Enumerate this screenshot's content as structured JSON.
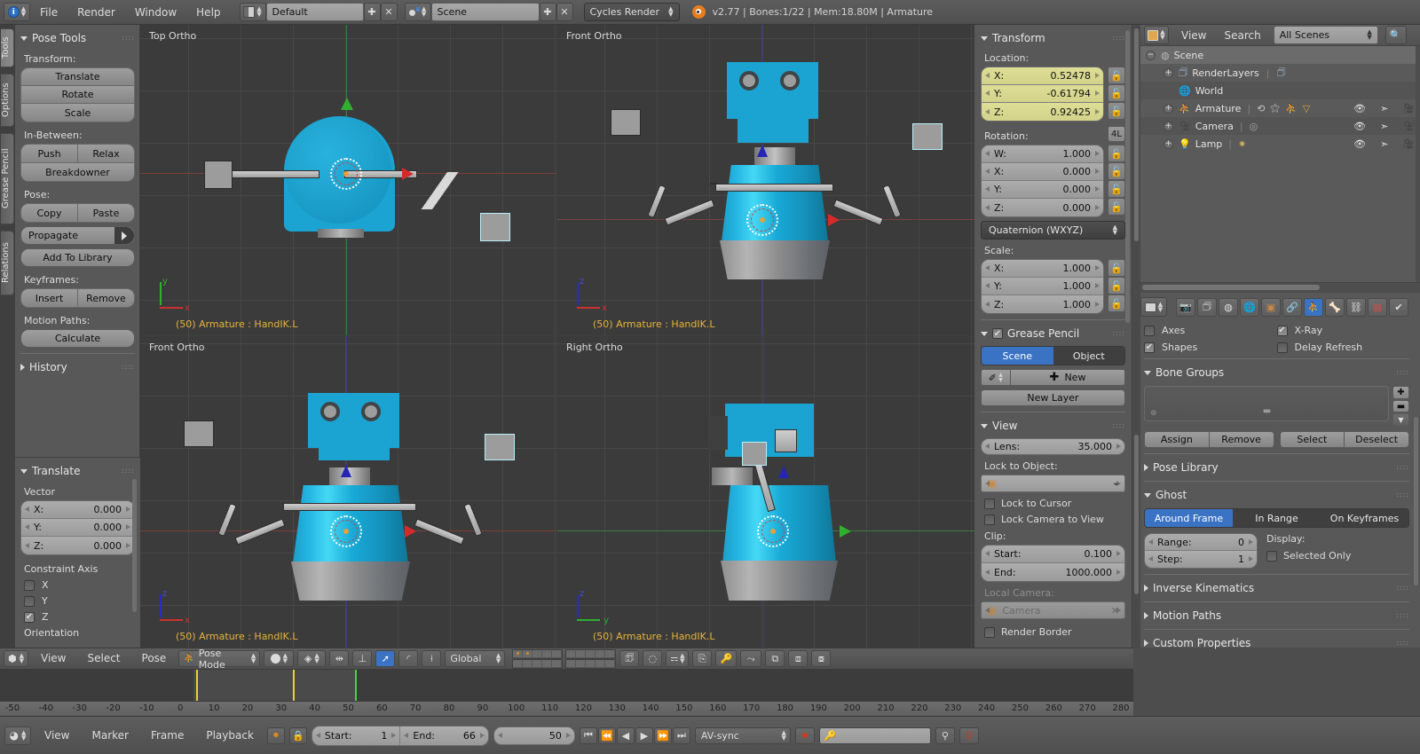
{
  "app": {
    "version_info": "v2.77 | Bones:1/22 | Mem:18.80M | Armature",
    "menus": [
      "File",
      "Render",
      "Window",
      "Help"
    ],
    "screen_layout": "Default",
    "scene_name": "Scene",
    "render_engine": "Cycles Render"
  },
  "toolshelf": {
    "tabs": [
      "Tools",
      "Options",
      "Grease Pencil",
      "Relations"
    ],
    "active_tab": "Tools",
    "panel_title": "Pose Tools",
    "groups": [
      {
        "label": "Transform:",
        "buttons": [
          "Translate",
          "Rotate",
          "Scale"
        ]
      },
      {
        "label": "In-Between:",
        "buttons": [
          "Push",
          "Relax",
          "Breakdowner"
        ]
      },
      {
        "label": "Pose:",
        "buttons": [
          "Copy",
          "Paste",
          "Propagate",
          "Add To Library"
        ]
      },
      {
        "label": "Keyframes:",
        "buttons": [
          "Insert",
          "Remove"
        ]
      },
      {
        "label": "Motion Paths:",
        "buttons": [
          "Calculate"
        ]
      }
    ],
    "history_title": "History"
  },
  "operator_panel": {
    "title": "Translate",
    "vector_label": "Vector",
    "vector": [
      {
        "label": "X:",
        "value": "0.000"
      },
      {
        "label": "Y:",
        "value": "0.000"
      },
      {
        "label": "Z:",
        "value": "0.000"
      }
    ],
    "constraint_label": "Constraint Axis",
    "axes": [
      {
        "label": "X",
        "checked": false
      },
      {
        "label": "Y",
        "checked": false
      },
      {
        "label": "Z",
        "checked": true
      }
    ],
    "orientation_label": "Orientation"
  },
  "viewports": [
    {
      "name": "Top Ortho",
      "info": "(50) Armature : HandIK.L",
      "gizmo": [
        "y",
        "x"
      ]
    },
    {
      "name": "Front Ortho",
      "info": "(50) Armature : HandIK.L",
      "gizmo": [
        "z",
        "x"
      ]
    },
    {
      "name": "Front Ortho",
      "info": "(50) Armature : HandIK.L",
      "gizmo": [
        "z",
        "x"
      ]
    },
    {
      "name": "Right Ortho",
      "info": "(50) Armature : HandIK.L",
      "gizmo": [
        "z",
        "y"
      ]
    }
  ],
  "properties": {
    "transform": {
      "title": "Transform",
      "location_label": "Location:",
      "location": [
        {
          "label": "X:",
          "value": "0.52478"
        },
        {
          "label": "Y:",
          "value": "-0.61794"
        },
        {
          "label": "Z:",
          "value": "0.92425"
        }
      ],
      "rotation_label": "Rotation:",
      "rotation_mode_badge": "4L",
      "rotation": [
        {
          "label": "W:",
          "value": "1.000"
        },
        {
          "label": "X:",
          "value": "0.000"
        },
        {
          "label": "Y:",
          "value": "0.000"
        },
        {
          "label": "Z:",
          "value": "0.000"
        }
      ],
      "rotation_mode": "Quaternion (WXYZ)",
      "scale_label": "Scale:",
      "scale": [
        {
          "label": "X:",
          "value": "1.000"
        },
        {
          "label": "Y:",
          "value": "1.000"
        },
        {
          "label": "Z:",
          "value": "1.000"
        }
      ]
    },
    "grease_pencil": {
      "title": "Grease Pencil",
      "enabled": true,
      "toggle": [
        "Scene",
        "Object"
      ],
      "active_toggle": "Scene",
      "new_button": "New",
      "new_layer_button": "New Layer"
    },
    "view": {
      "title": "View",
      "lens": {
        "label": "Lens:",
        "value": "35.000"
      },
      "lock_to_object_label": "Lock to Object:",
      "lock_to_object_value": "",
      "lock_to_cursor": "Lock to Cursor",
      "lock_camera_to_view": "Lock Camera to View",
      "clip_label": "Clip:",
      "clip_start": {
        "label": "Start:",
        "value": "0.100"
      },
      "clip_end": {
        "label": "End:",
        "value": "1000.000"
      },
      "local_camera_label": "Local Camera:",
      "local_camera_value": "Camera",
      "render_border": "Render Border"
    }
  },
  "outliner": {
    "menus": [
      "View",
      "Search"
    ],
    "scope": "All Scenes",
    "rows": [
      {
        "name": "Scene",
        "icon": "scene-icon",
        "depth": 0,
        "expander": "minus",
        "highlight": true,
        "extra": []
      },
      {
        "name": "RenderLayers",
        "icon": "renderlayers-icon",
        "depth": 1,
        "expander": "plus",
        "highlight": false,
        "extra": [
          "renderlayer"
        ]
      },
      {
        "name": "World",
        "icon": "world-icon",
        "depth": 1,
        "expander": "none",
        "highlight": false,
        "extra": []
      },
      {
        "name": "Armature",
        "icon": "armature-icon",
        "depth": 1,
        "expander": "plus",
        "highlight": false,
        "extra": [
          "modifier",
          "pose",
          "armature-data",
          "cone"
        ],
        "visibility": true
      },
      {
        "name": "Camera",
        "icon": "camera-icon",
        "depth": 1,
        "expander": "plus",
        "highlight": false,
        "extra": [
          "camera-data"
        ],
        "visibility": true
      },
      {
        "name": "Lamp",
        "icon": "lamp-icon",
        "depth": 1,
        "expander": "plus",
        "highlight": false,
        "extra": [
          "lamp-data"
        ],
        "visibility": true
      }
    ]
  },
  "object_data": {
    "tabs": [
      "render-icon",
      "render-layers-icon",
      "scene-icon",
      "world-icon",
      "object-icon",
      "constraints-icon",
      "armature-icon",
      "bone-icon",
      "bone-constraint-icon",
      "texture-icon",
      "physics-icon"
    ],
    "active_tab_index": 6,
    "display_options": [
      {
        "label": "Axes",
        "checked": false
      },
      {
        "label": "X-Ray",
        "checked": true
      },
      {
        "label": "Shapes",
        "checked": true
      },
      {
        "label": "Delay Refresh",
        "checked": false
      }
    ],
    "bone_groups": {
      "title": "Bone Groups",
      "buttons": [
        "Assign",
        "Remove",
        "Select",
        "Deselect"
      ]
    },
    "pose_library_title": "Pose Library",
    "ghost": {
      "title": "Ghost",
      "modes": [
        "Around Frame",
        "In Range",
        "On Keyframes"
      ],
      "active_mode": "Around Frame",
      "range": {
        "label": "Range:",
        "value": "0"
      },
      "step": {
        "label": "Step:",
        "value": "1"
      },
      "display_label": "Display:",
      "selected_only": "Selected Only"
    },
    "collapsed_panels": [
      "Inverse Kinematics",
      "Motion Paths",
      "Custom Properties"
    ]
  },
  "view3d_header": {
    "menus": [
      "View",
      "Select",
      "Pose"
    ],
    "mode": "Pose Mode",
    "orientation": "Global",
    "layer_rows": 2,
    "layer_cols": 10
  },
  "timeline": {
    "menus": [
      "View",
      "Marker",
      "Frame",
      "Playback"
    ],
    "start": {
      "label": "Start:",
      "value": "1"
    },
    "end": {
      "label": "End:",
      "value": "66"
    },
    "current_frame": "50",
    "sync_mode": "AV-sync",
    "ticks": [
      -50,
      -40,
      -30,
      -20,
      -10,
      0,
      10,
      20,
      30,
      40,
      50,
      60,
      70,
      80,
      90,
      100,
      110,
      120,
      130,
      140,
      150,
      160,
      170,
      180,
      190,
      200,
      210,
      220,
      230,
      240,
      250,
      260,
      270,
      280
    ],
    "keyframes": [
      0,
      30
    ],
    "playhead": 50,
    "range_highlight": {
      "from": 1,
      "to": 66
    }
  },
  "colors": {
    "accent_blue": "#3b73c4",
    "robot_body": "#1ba3d1",
    "keyframe_yellow": "#e3d432",
    "playhead_green": "#4ad14a",
    "info_text": "#e8b33a",
    "field_yellow": "#dede96"
  }
}
